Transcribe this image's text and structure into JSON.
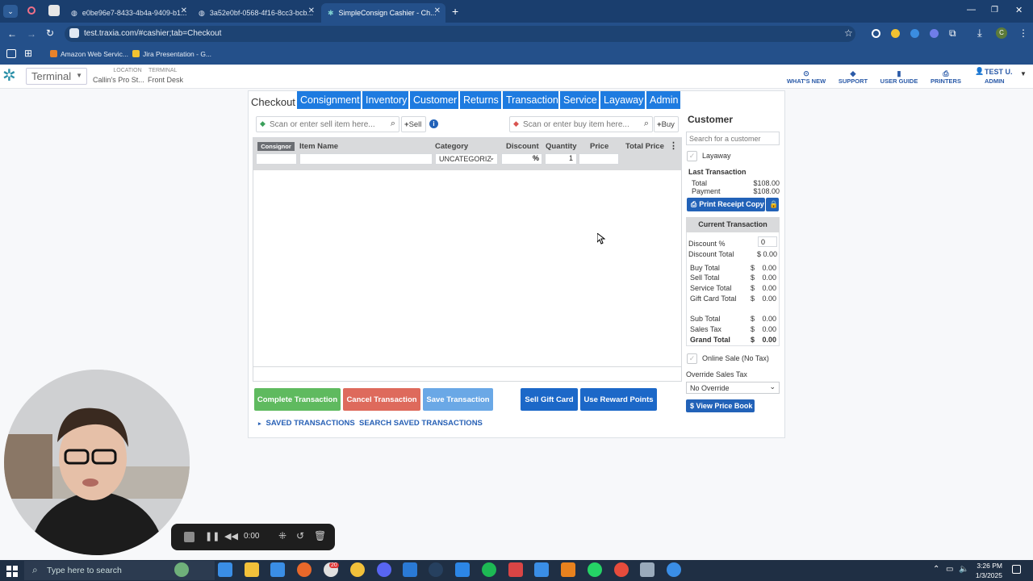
{
  "browser": {
    "tabs": [
      {
        "label": "e0be96e7-8433-4b4a-9409-b1..."
      },
      {
        "label": "3a52e0bf-0568-4f16-8cc3-bcb..."
      },
      {
        "label": "SimpleConsign Cashier - Ch..."
      }
    ],
    "url": "test.traxia.com/#cashier;tab=Checkout",
    "bookmarks": [
      "Amazon Web Servic...",
      "Jira Presentation - G..."
    ]
  },
  "app": {
    "terminal_select": "Terminal",
    "location_label": "LOCATION",
    "location_value": "Callin's Pro St...",
    "terminal_label": "TERMINAL",
    "terminal_value": "Front Desk",
    "header_links": [
      "WHAT'S NEW",
      "SUPPORT",
      "USER GUIDE",
      "PRINTERS"
    ],
    "user_name": "TEST U.",
    "user_role": "ADMIN"
  },
  "nav": {
    "active": "Checkout",
    "tabs": [
      "Consignment",
      "Inventory",
      "Customer",
      "Returns",
      "Transaction",
      "Service",
      "Layaway",
      "Admin"
    ]
  },
  "checkout": {
    "sell_placeholder": "Scan or enter sell item here...",
    "sell_button": "Sell",
    "buy_placeholder": "Scan or enter buy item here...",
    "buy_button": "Buy",
    "columns": [
      "Consignor",
      "Item Name",
      "Category",
      "Discount",
      "Quantity",
      "Price",
      "Total Price"
    ],
    "row": {
      "category": "UNCATEGORIZ",
      "discount_symbol": "%",
      "quantity": "1"
    },
    "buttons": {
      "complete": "Complete Transaction",
      "cancel": "Cancel Transaction",
      "save": "Save Transaction",
      "gift": "Sell Gift Card",
      "reward": "Use Reward Points"
    },
    "links": {
      "saved": "SAVED TRANSACTIONS",
      "search_saved": "SEARCH SAVED TRANSACTIONS"
    }
  },
  "customer_panel": {
    "title": "Customer",
    "search_placeholder": "Search for a customer",
    "layaway_label": "Layaway",
    "last_transaction_title": "Last Transaction",
    "last_total_label": "Total",
    "last_total_value": "$108.00",
    "last_payment_label": "Payment",
    "last_payment_value": "$108.00",
    "print_receipt": "Print Receipt Copy",
    "current_title": "Current Transaction",
    "discount_pct_label": "Discount %",
    "discount_pct_value": "0",
    "discount_total_label": "Discount Total",
    "discount_total_value": "$ 0.00",
    "totals": [
      {
        "label": "Buy Total",
        "cur": "$",
        "value": "0.00"
      },
      {
        "label": "Sell Total",
        "cur": "$",
        "value": "0.00"
      },
      {
        "label": "Service Total",
        "cur": "$",
        "value": "0.00"
      },
      {
        "label": "Gift Card Total",
        "cur": "$",
        "value": "0.00"
      }
    ],
    "subtotals": [
      {
        "label": "Sub Total",
        "cur": "$",
        "value": "0.00"
      },
      {
        "label": "Sales Tax",
        "cur": "$",
        "value": "0.00"
      },
      {
        "label": "Grand Total",
        "cur": "$",
        "value": "0.00"
      }
    ],
    "online_sale_label": "Online Sale (No Tax)",
    "override_label": "Override Sales Tax",
    "override_value": "No Override",
    "price_book": "$ View Price Book"
  },
  "recorder": {
    "time": "0:00"
  },
  "taskbar": {
    "search_placeholder": "Type here to search",
    "time": "3:26 PM",
    "date": "1/3/2025",
    "badge": "20"
  },
  "colors": {
    "nav_blue": "#1e7be0",
    "complete_green": "#5fba5f",
    "cancel_red": "#de6a5c",
    "save_blue": "#6aa8e6",
    "gift_blue": "#1c68c8"
  }
}
